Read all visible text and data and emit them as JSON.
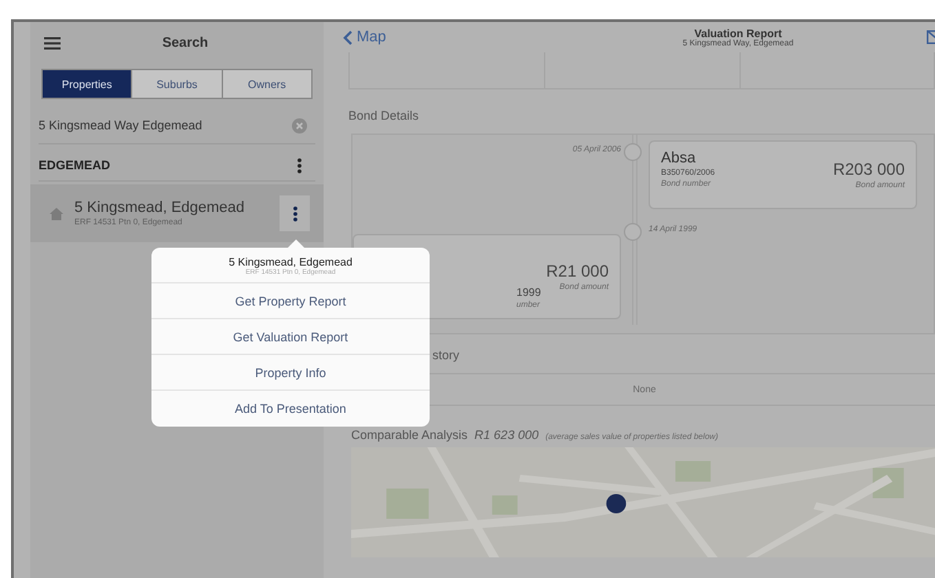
{
  "sidebar": {
    "title": "Search",
    "segments": [
      {
        "label": "Properties",
        "selected": true
      },
      {
        "label": "Suburbs",
        "selected": false
      },
      {
        "label": "Owners",
        "selected": false
      }
    ],
    "search": {
      "value": "5 Kingsmead Way Edgemead"
    },
    "group": {
      "name": "EDGEMEAD"
    },
    "results": [
      {
        "title": "5 Kingsmead, Edgemead",
        "subtitle": "ERF 14531 Ptn 0, Edgemead"
      }
    ]
  },
  "main": {
    "back_label": "Map",
    "title": "Valuation Report",
    "subtitle": "5 Kingsmead Way, Edgemead",
    "bond_details": {
      "heading": "Bond Details",
      "entries": [
        {
          "kind": "right",
          "date": "05 April 2006",
          "bank": "Absa",
          "number": "B350760/2006",
          "number_label": "Bond number",
          "amount": "R203 000",
          "amount_label": "Bond amount"
        },
        {
          "kind": "left",
          "date": "14 April 1999",
          "number": "1999",
          "number_label": "umber",
          "amount": "R21 000",
          "amount_label": "Bond amount"
        }
      ]
    },
    "history": {
      "heading": "story",
      "value": "None"
    },
    "comparable": {
      "heading": "Comparable Analysis",
      "amount": "R1 623 000",
      "note": "(average sales value of properties listed below)"
    }
  },
  "popover": {
    "title": "5 Kingsmead, Edgemead",
    "subtitle": "ERF 14531 Ptn 0, Edgemead",
    "items": [
      {
        "label": "Get Property Report"
      },
      {
        "label": "Get Valuation Report"
      },
      {
        "label": "Property Info"
      },
      {
        "label": "Add To Presentation"
      }
    ]
  }
}
